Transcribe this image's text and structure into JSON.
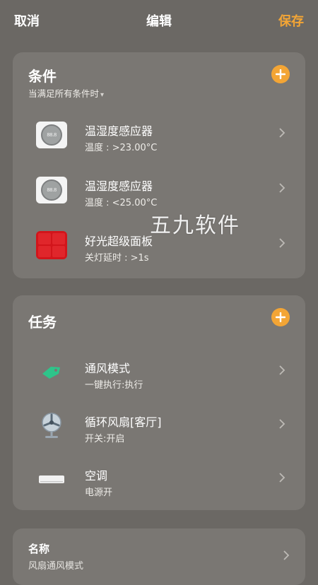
{
  "topbar": {
    "cancel_label": "取消",
    "title": "编辑",
    "save_label": "保存"
  },
  "conditions": {
    "title": "条件",
    "subtitle": "当满足所有条件时",
    "items": [
      {
        "label": "温湿度感应器",
        "detail": "温度 : >23.00°C",
        "icon": "thermo-hygrometer-icon"
      },
      {
        "label": "温湿度感应器",
        "detail": "温度 : <25.00°C",
        "icon": "thermo-hygrometer-icon"
      },
      {
        "label": "好光超级面板",
        "detail": "关灯延时 : >1s",
        "icon": "light-panel-icon"
      }
    ]
  },
  "tasks": {
    "title": "任务",
    "items": [
      {
        "label": "通风模式",
        "detail": "一键执行:执行",
        "icon": "scene-tag-icon"
      },
      {
        "label": "循环风扇[客厅]",
        "detail": "开关:开启",
        "icon": "fan-icon"
      },
      {
        "label": "空调",
        "detail": "电源开",
        "icon": "air-conditioner-icon"
      }
    ]
  },
  "name_section": {
    "label": "名称",
    "value": "风扇通风模式"
  },
  "watermark": "五九软件",
  "colors": {
    "background": "#6b6864",
    "card": "#7a7773",
    "accent": "#f3a535"
  }
}
